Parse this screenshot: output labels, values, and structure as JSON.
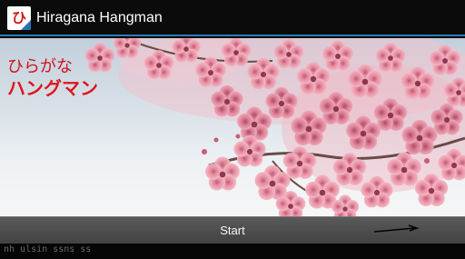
{
  "app": {
    "title": "Hiragana Hangman",
    "icon_glyph": "ひ",
    "icon": "hiragana-hi-app-icon"
  },
  "banner": {
    "line1": "ひらがな",
    "line2": "ハングマン",
    "color": "#d1121b"
  },
  "start_bar": {
    "label": "Start",
    "arrow_icon": "right-arrow-icon"
  },
  "footer": {
    "text": "nh ulsin ssns  ss"
  },
  "colors": {
    "titlebar_bg": "#0b0b0b",
    "titlebar_accent": "#2d7fb6",
    "start_bar_bg": "#4a4a4a",
    "blossom_pink": "#f3b1c0"
  }
}
